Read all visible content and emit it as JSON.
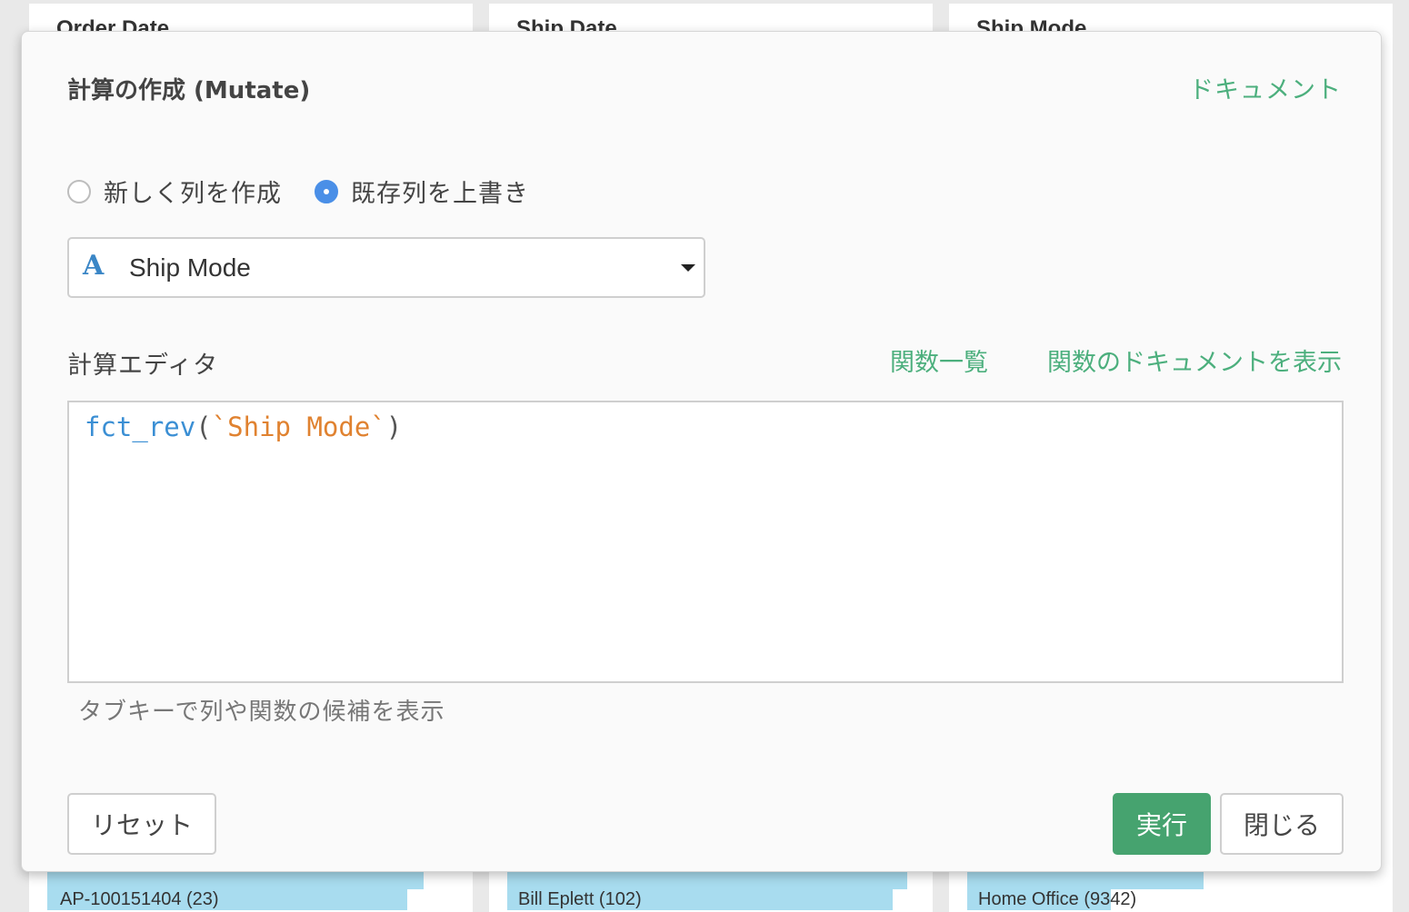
{
  "background": {
    "columns": [
      {
        "title": "Order Date",
        "bar_text": "AP-100151404 (23)"
      },
      {
        "title": "Ship Date",
        "bar_text": "Bill Eplett (102)"
      },
      {
        "title": "Ship Mode",
        "bar_text": "Home Office (9342)"
      }
    ]
  },
  "modal": {
    "title": "計算の作成 (Mutate)",
    "doc_link": "ドキュメント",
    "radio_new": "新しく列を作成",
    "radio_overwrite": "既存列を上書き",
    "selected_radio": "overwrite",
    "column_select": {
      "type_icon": "A",
      "value": "Ship Mode"
    },
    "editor_label": "計算エディタ",
    "function_list_link": "関数一覧",
    "function_doc_link": "関数のドキュメントを表示",
    "code": {
      "fn": "fct_rev",
      "open": "(",
      "arg": "`Ship Mode`",
      "close": ")"
    },
    "hint": "タブキーで列や関数の候補を表示",
    "reset_button": "リセット",
    "run_button": "実行",
    "close_button": "閉じる"
  },
  "colors": {
    "accent_green": "#4caf7d",
    "run_button": "#46a36f",
    "radio_selected": "#4a8fe7",
    "code_function": "#3b8fd4",
    "code_column": "#e08230"
  }
}
